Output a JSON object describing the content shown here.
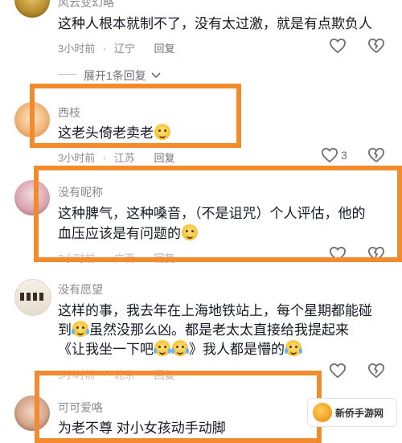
{
  "comments": [
    {
      "id": "c0",
      "username": "风云变幻略",
      "lines": [
        "这种人根本就制不了，没有太过激，就是有点欺负人"
      ],
      "time": "3小时前",
      "location": "辽宁",
      "reply_label": "回复",
      "like_count": ""
    },
    {
      "id": "c1",
      "username": "西枝",
      "lines": [
        "这老头倚老卖老"
      ],
      "time": "3小时前",
      "location": "江苏",
      "reply_label": "回复",
      "like_count": "3"
    },
    {
      "id": "c2",
      "username": "没有昵称",
      "lines": [
        "这种脾气，这种嗓音，（不是诅咒）个人评估，他的",
        "血压应该是有问题的"
      ],
      "time": "3小时前",
      "location": "广西",
      "reply_label": "回复",
      "like_count": ""
    },
    {
      "id": "c3",
      "username": "没有愿望",
      "lines": [
        "这样的事，我去年在上海地铁站上，每个星期都能碰",
        "到",
        "虽然没那么凶。都是老太太直接给我提起来",
        "《让我坐一下吧",
        "》我人都是懵的"
      ],
      "time": "3小时前",
      "location": "北京",
      "reply_label": "回复",
      "like_count": ""
    },
    {
      "id": "c4",
      "username": "可可爱咯",
      "lines": [
        "为老不尊 对小女孩动手动脚"
      ],
      "time": "",
      "location": "",
      "reply_label": "",
      "like_count": ""
    }
  ],
  "expand_replies_label": "展开1条回复",
  "watermark_text": "新侨手游网",
  "colors": {
    "highlight": "#f28a2e",
    "meta_gray": "#8a8b91",
    "text": "#161823"
  },
  "icons": {
    "like": "heart-outline-icon",
    "dislike": "broken-heart-outline-icon",
    "expand": "chevron-down-icon"
  }
}
